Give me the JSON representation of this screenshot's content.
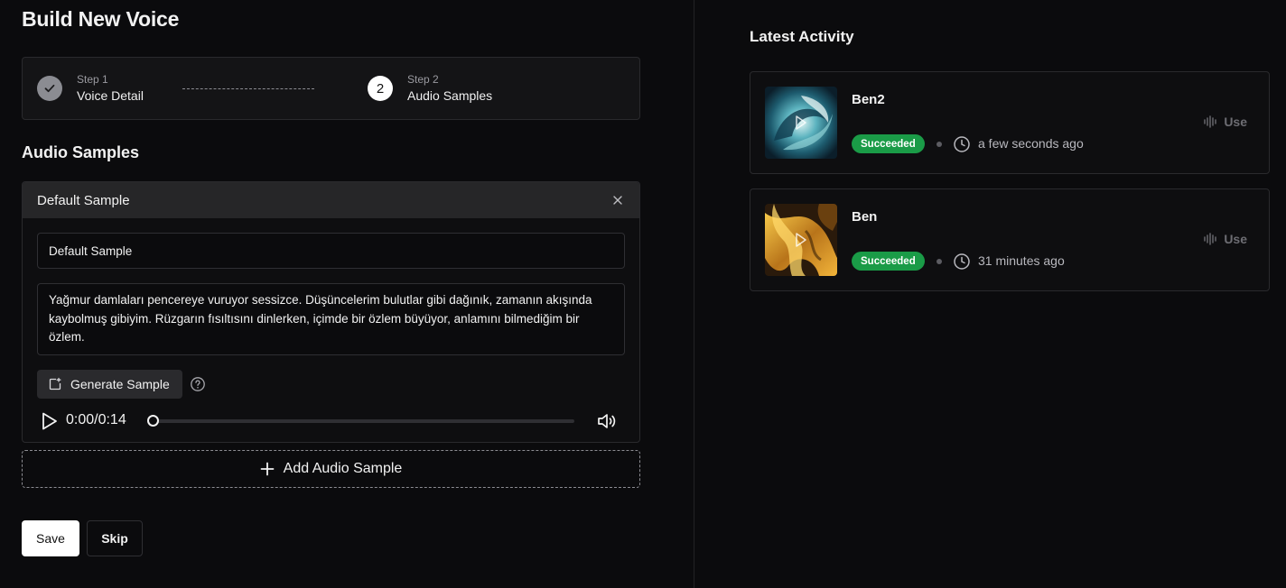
{
  "page": {
    "title": "Build New Voice"
  },
  "stepper": {
    "steps": [
      {
        "small": "Step 1",
        "label": "Voice Detail",
        "status": "done"
      },
      {
        "small": "Step 2",
        "label": "Audio Samples",
        "number": "2",
        "status": "active"
      }
    ]
  },
  "samples": {
    "section_title": "Audio Samples",
    "card": {
      "header": "Default Sample",
      "name_value": "Default Sample",
      "text_value": "Yağmur damlaları pencereye vuruyor sessizce. Düşüncelerim bulutlar gibi dağınık, zamanın akışında kaybolmuş gibiyim. Rüzgarın fısıltısını dinlerken, içimde bir özlem büyüyor, anlamını bilmediğim bir özlem.",
      "generate_label": "Generate Sample",
      "player_time": "0:00/0:14",
      "progress": 0
    },
    "add_label": "Add Audio Sample"
  },
  "actions": {
    "save_label": "Save",
    "skip_label": "Skip"
  },
  "activity": {
    "title": "Latest Activity",
    "items": [
      {
        "name": "Ben2",
        "status": "Succeeded",
        "time": "a few seconds ago",
        "use_label": "Use"
      },
      {
        "name": "Ben",
        "status": "Succeeded",
        "time": "31 minutes ago",
        "use_label": "Use"
      }
    ]
  },
  "colors": {
    "background": "#0b0b0d",
    "success": "#1a9b47",
    "primary_button": "#ffffff"
  }
}
